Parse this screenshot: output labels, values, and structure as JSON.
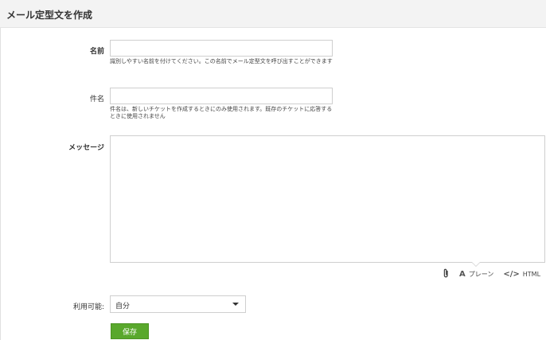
{
  "header": {
    "title": "メール定型文を作成"
  },
  "form": {
    "name": {
      "label": "名前",
      "value": "",
      "hint": "識別しやすい名前を付けてください。この名前でメール定型文を呼び出すことができます"
    },
    "subject": {
      "label": "件名",
      "value": "",
      "hint": "件名は、新しいチケットを作成するときにのみ使用されます。既存のチケットに応答するときに使用されません"
    },
    "message": {
      "label": "メッセージ",
      "value": ""
    },
    "toolbar": {
      "attach_icon": "paperclip-icon",
      "plain_glyph": "A",
      "plain_label": "プレーン",
      "html_glyph": "</>",
      "html_label": "HTML"
    },
    "availability": {
      "label": "利用可能:",
      "selected": "自分"
    },
    "save_label": "保存"
  },
  "colors": {
    "save_button": "#59a82c",
    "header_bg": "#f3f3f3"
  }
}
